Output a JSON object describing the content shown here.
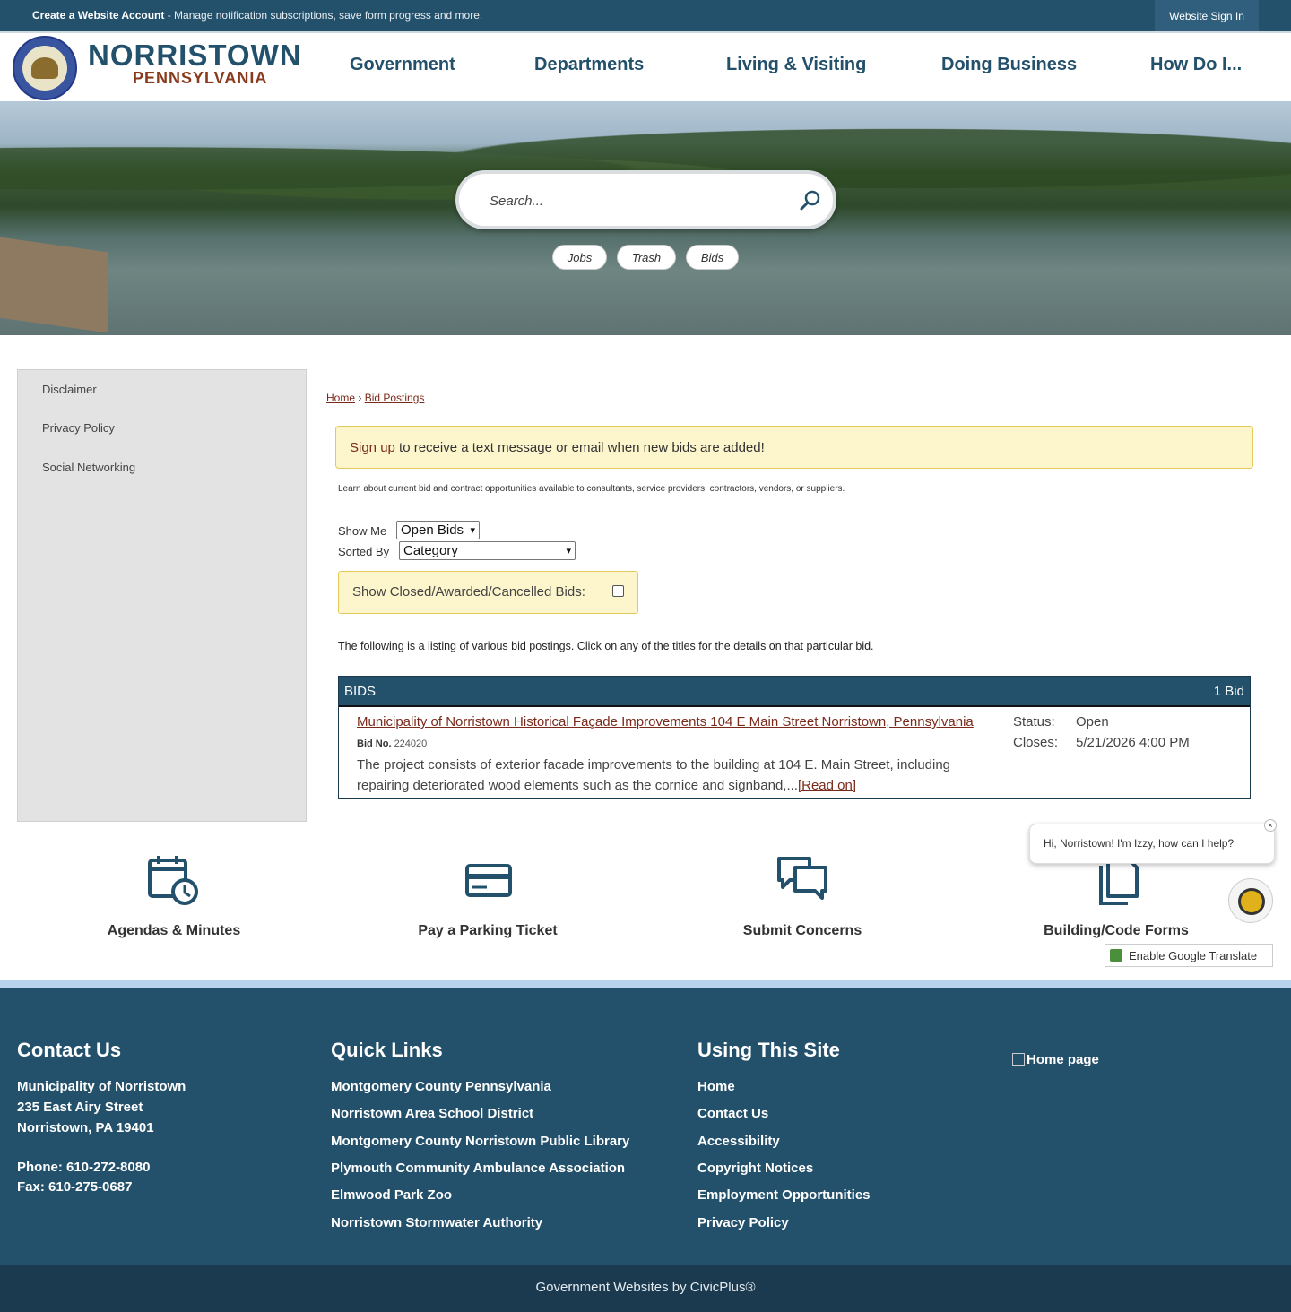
{
  "topbar": {
    "create_account": "Create a Website Account",
    "create_desc": " - Manage notification subscriptions, save form progress and more.",
    "sign_in": "Website Sign In"
  },
  "brand": {
    "name": "NORRISTOWN",
    "sub": "PENNSYLVANIA"
  },
  "nav": [
    "Government",
    "Departments",
    "Living & Visiting",
    "Doing Business",
    "How Do I..."
  ],
  "hero": {
    "search_placeholder": "Search...",
    "quick_links": [
      "Jobs",
      "Trash",
      "Bids"
    ]
  },
  "sidebar": [
    "Disclaimer",
    "Privacy Policy",
    "Social Networking"
  ],
  "breadcrumb": {
    "home": "Home",
    "sep": " › ",
    "current": "Bid Postings"
  },
  "notice": {
    "link": "Sign up",
    "text": " to receive a text message or email when new bids are added!"
  },
  "intro": "Learn about current bid and contract opportunities available to consultants, service providers, contractors, vendors, or suppliers.",
  "filters": {
    "show_me_label": "Show Me",
    "show_me_value": "Open Bids",
    "sorted_by_label": "Sorted By",
    "sorted_by_value": "Category",
    "closed_label": "Show Closed/Awarded/Cancelled Bids:"
  },
  "listing_note": "The following is a listing of various bid postings. Click on any of the titles for the details on that particular bid.",
  "bids": {
    "header": "BIDS",
    "count": "1 Bid",
    "items": [
      {
        "title": "Municipality of Norristown Historical Façade Improvements 104 E Main Street Norristown, Pennsylvania",
        "bid_no_label": "Bid No.",
        "bid_no": "224020",
        "description": "The project consists of exterior facade improvements to the building at 104 E. Main Street, including repairing deteriorated wood elements such as the cornice and signband,...",
        "read_on": "[Read on]",
        "status_label": "Status:",
        "status": "Open",
        "closes_label": "Closes:",
        "closes": "5/21/2026 4:00 PM"
      }
    ]
  },
  "quick_icons": [
    {
      "label": "Agendas & Minutes",
      "icon": "calendar-clock-icon"
    },
    {
      "label": "Pay a Parking Ticket",
      "icon": "credit-card-icon"
    },
    {
      "label": "Submit Concerns",
      "icon": "chat-bubbles-icon"
    },
    {
      "label": "Building/Code Forms",
      "icon": "documents-icon"
    }
  ],
  "chat": {
    "greeting": "Hi, Norristown! I'm Izzy, how can I help?",
    "close": "×"
  },
  "translate": "Enable Google Translate",
  "footer": {
    "contact": {
      "heading": "Contact Us",
      "org": "Municipality of Norristown",
      "street": "235 East Airy Street",
      "city": "Norristown, PA 19401",
      "phone": "Phone: 610-272-8080",
      "fax": "Fax: 610-275-0687"
    },
    "quick_links": {
      "heading": "Quick Links",
      "items": [
        "Montgomery County Pennsylvania",
        "Norristown Area School District",
        "Montgomery County Norristown Public Library",
        "Plymouth Community Ambulance Association",
        "Elmwood Park Zoo",
        "Norristown Stormwater Authority"
      ]
    },
    "using_site": {
      "heading": "Using This Site",
      "items": [
        "Home",
        "Contact Us",
        "Accessibility",
        "Copyright Notices",
        "Employment Opportunities",
        "Privacy Policy"
      ]
    },
    "home_page_alt": "Home page",
    "credit": "Government Websites by CivicPlus®"
  }
}
